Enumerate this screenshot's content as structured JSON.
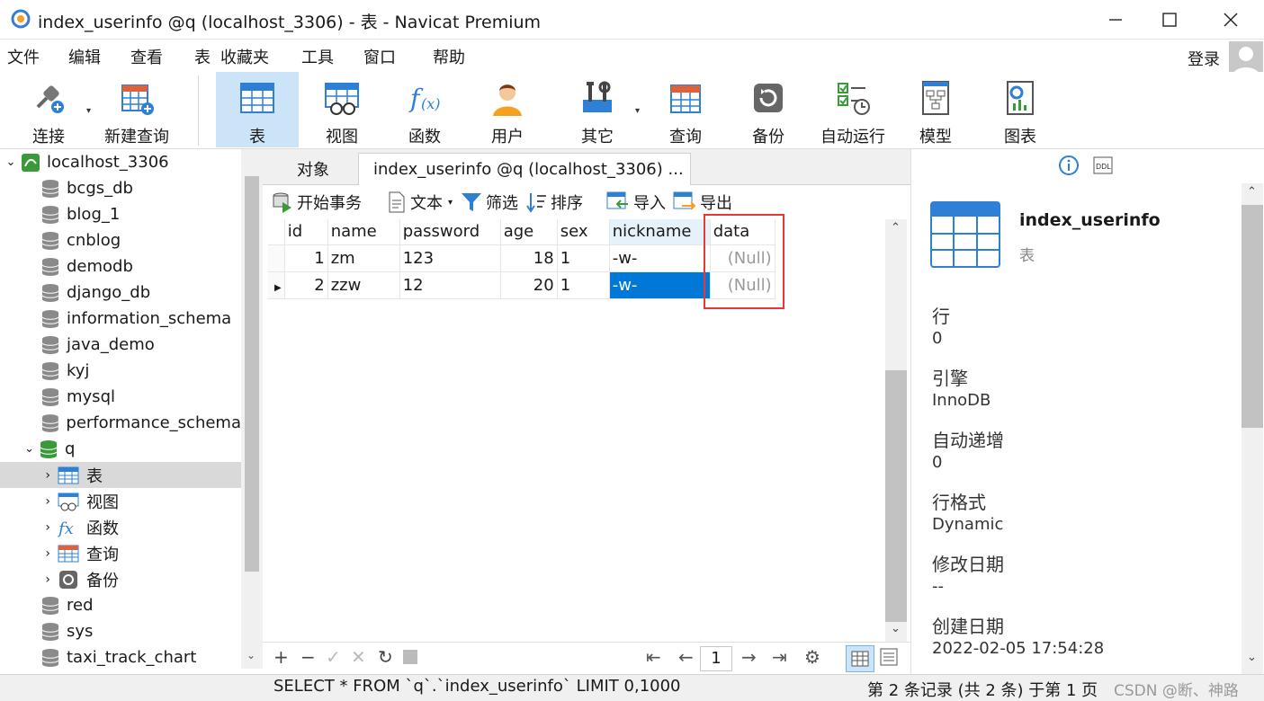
{
  "window": {
    "title": "index_userinfo @q (localhost_3306) - 表 - Navicat Premium",
    "minimize_icon": "minimize-icon",
    "maximize_icon": "maximize-icon",
    "close_icon": "close-icon"
  },
  "menu": {
    "items": [
      "文件",
      "编辑",
      "查看",
      "表",
      "收藏夹",
      "工具",
      "窗口",
      "帮助"
    ],
    "login": "登录"
  },
  "toolbar": {
    "buttons": [
      {
        "label": "连接",
        "icon": "connect-plug-icon"
      },
      {
        "label": "新建查询",
        "icon": "new-query-icon"
      },
      {
        "label": "表",
        "icon": "table-icon"
      },
      {
        "label": "视图",
        "icon": "view-icon"
      },
      {
        "label": "函数",
        "icon": "function-icon"
      },
      {
        "label": "用户",
        "icon": "user-icon"
      },
      {
        "label": "其它",
        "icon": "other-tools-icon"
      },
      {
        "label": "查询",
        "icon": "query-icon"
      },
      {
        "label": "备份",
        "icon": "backup-icon"
      },
      {
        "label": "自动运行",
        "icon": "autorun-icon"
      },
      {
        "label": "模型",
        "icon": "model-icon"
      },
      {
        "label": "图表",
        "icon": "chart-icon"
      }
    ]
  },
  "tree": {
    "connection": "localhost_3306",
    "databases": [
      "bcgs_db",
      "blog_1",
      "cnblog",
      "demodb",
      "django_db",
      "information_schema",
      "java_demo",
      "kyj",
      "mysql",
      "performance_schema"
    ],
    "open_db": "q",
    "open_db_children": [
      "表",
      "视图",
      "函数",
      "查询",
      "备份"
    ],
    "databases_after": [
      "red",
      "sys",
      "taxi_track_chart"
    ]
  },
  "tabs": {
    "objects": "对象",
    "active": "index_userinfo @q (localhost_3306) ..."
  },
  "subtoolbar": {
    "begin_transaction": "开始事务",
    "text": "文本",
    "filter": "筛选",
    "sort": "排序",
    "import": "导入",
    "export": "导出"
  },
  "grid": {
    "columns": [
      "id",
      "name",
      "password",
      "age",
      "sex",
      "nickname",
      "data"
    ],
    "rows": [
      {
        "id": "1",
        "name": "zm",
        "password": "123",
        "age": "18",
        "sex": "1",
        "nickname": "-w-",
        "data": "(Null)"
      },
      {
        "id": "2",
        "name": "zzw",
        "password": "12",
        "age": "20",
        "sex": "1",
        "nickname": "-w-",
        "data": "(Null)"
      }
    ]
  },
  "pager": {
    "page": "1"
  },
  "status": {
    "sql": "SELECT * FROM `q`.`index_userinfo` LIMIT 0,1000",
    "records": "第 2 条记录 (共 2 条) 于第 1 页",
    "watermark": "CSDN @断、神路"
  },
  "properties": {
    "name": "index_userinfo",
    "type": "表",
    "items": [
      {
        "label": "行",
        "value": "0"
      },
      {
        "label": "引擎",
        "value": "InnoDB"
      },
      {
        "label": "自动递增",
        "value": "0"
      },
      {
        "label": "行格式",
        "value": "Dynamic"
      },
      {
        "label": "修改日期",
        "value": "--"
      },
      {
        "label": "创建日期",
        "value": "2022-02-05 17:54:28"
      }
    ]
  },
  "colors": {
    "accent": "#0078d7",
    "active_tab_bg": "#cce4f7",
    "highlight_box": "#e53935",
    "null_text": "#9a9a9a"
  }
}
